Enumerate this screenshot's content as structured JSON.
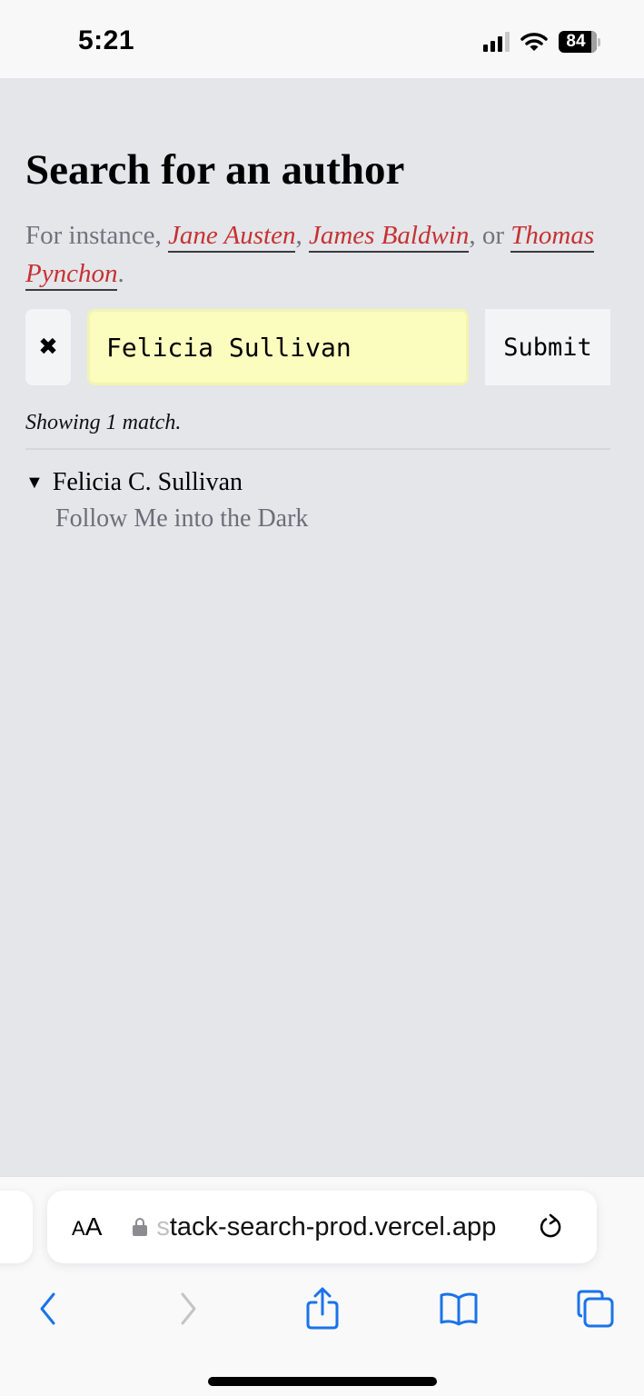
{
  "status_bar": {
    "time": "5:21",
    "battery_level": "84",
    "signal_bars_active": 3,
    "signal_bars_total": 4
  },
  "page": {
    "title": "Search for an author",
    "intro_prefix": "For instance, ",
    "examples": [
      "Jane Austen",
      "James Baldwin",
      "Thomas Pynchon"
    ],
    "sep1": ", ",
    "sep2": ", or ",
    "intro_suffix": ".",
    "link_color": "#c53232"
  },
  "search": {
    "clear_label": "✖",
    "query_value": "Felicia Sullivan",
    "submit_label": "Submit",
    "input_bg": "#fbfdbe"
  },
  "results": {
    "summary": "Showing 1 match.",
    "items": [
      {
        "author": "Felicia C. Sullivan",
        "expanded": true,
        "books": [
          "Follow Me into the Dark"
        ]
      }
    ]
  },
  "browser": {
    "aa_label_small": "A",
    "aa_label_large": "A",
    "url_fade": "s",
    "url": "tack-search-prod.vercel.app",
    "accent_color": "#1a73e8",
    "toolbar": {
      "back": "back-icon",
      "forward": "forward-icon",
      "share": "share-icon",
      "bookmarks": "bookmarks-icon",
      "tabs": "tabs-icon"
    }
  }
}
